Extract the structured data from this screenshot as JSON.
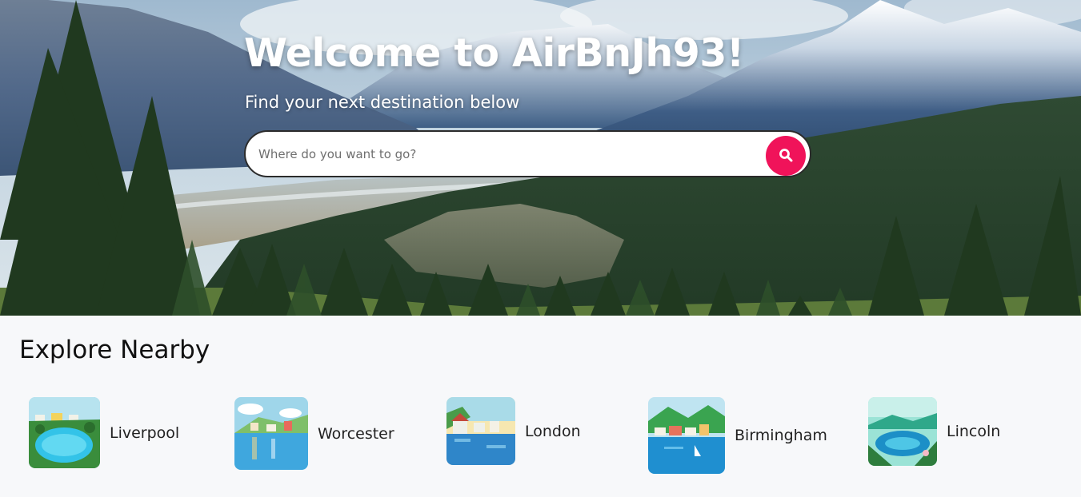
{
  "hero": {
    "title": "Welcome to AirBnJh93!",
    "subtitle": "Find your next destination below"
  },
  "search": {
    "placeholder": "Where do you want to go?",
    "button_icon": "search-icon",
    "button_color": "#f0135a"
  },
  "explore": {
    "title": "Explore Nearby",
    "places": [
      {
        "name": "Liverpool"
      },
      {
        "name": "Worcester"
      },
      {
        "name": "London"
      },
      {
        "name": "Birmingham"
      },
      {
        "name": "Lincoln"
      }
    ]
  }
}
